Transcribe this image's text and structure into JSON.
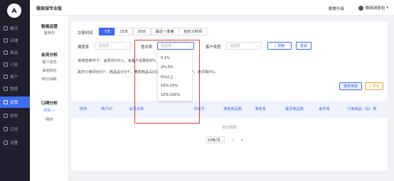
{
  "topbar": {
    "store_name": "微商城专业版",
    "upgrade": "套餐升级",
    "user": "微商城体验"
  },
  "sidebar": {
    "items": [
      {
        "label": "概况",
        "icon": "home-icon"
      },
      {
        "label": "店铺",
        "icon": "store-icon"
      },
      {
        "label": "商品",
        "icon": "goods-icon"
      },
      {
        "label": "订单",
        "icon": "order-icon"
      },
      {
        "label": "客户",
        "icon": "customer-icon"
      },
      {
        "label": "数据",
        "icon": "data-icon"
      },
      {
        "label": "运营",
        "icon": "operate-icon"
      },
      {
        "label": "财务",
        "icon": "finance-icon"
      },
      {
        "label": "应用",
        "icon": "app-icon"
      },
      {
        "label": "设置",
        "icon": "settings-icon"
      }
    ],
    "active": "运营"
  },
  "subnav": {
    "groups": [
      {
        "title": "智能运营",
        "items": [
          "客单价"
        ]
      },
      {
        "title": "会员分析",
        "items": [
          "客户信息",
          "渠道转化",
          "积分消耗"
        ]
      },
      {
        "title": "口碑分析",
        "items": [
          "评价",
          "物权"
        ]
      }
    ],
    "active_item": "评价"
  },
  "filters": {
    "time_label": "交易时间",
    "time_tabs": [
      "7天",
      "15天",
      "30天",
      "最近一季度",
      "自定义时间"
    ],
    "active_tab": "7天",
    "satisfaction_label": "满意率",
    "satisfaction_placeholder": "请选择",
    "bad_rate_label": "差评率",
    "bad_rate_placeholder": "请选择",
    "customer_type_label": "客户类型",
    "customer_type_placeholder": "请选择",
    "search_button": "搜索",
    "reset_button": "重置"
  },
  "info": {
    "line1": "该筛选条件下：会员共计0人，会客户总数的0%",
    "line2": "其中订单评价0个，商品总计0个，满意商品占比0%，差评商品共计0个，差评率0%；"
  },
  "table": {
    "actions": {
      "reset_filter": "重新筛选",
      "export": "导出"
    },
    "headers": [
      "排序",
      "商户ID",
      "会员名称",
      "手机号",
      "满意商品数",
      "满意率",
      "差评商品数",
      "差评率",
      "订单商品（总）数"
    ],
    "empty_text": "暂无数据"
  },
  "pagination": {
    "page_size": "10条/页",
    "prev": "‹",
    "next": "›"
  },
  "dropdown": {
    "options": [
      "0-1%",
      "2%-5%",
      "5%以上",
      "10%-15%",
      "10%-100%"
    ]
  },
  "colors": {
    "accent": "#3d6bf2",
    "sidebar_bg": "#1f1f2e",
    "highlight": "#e53935"
  }
}
